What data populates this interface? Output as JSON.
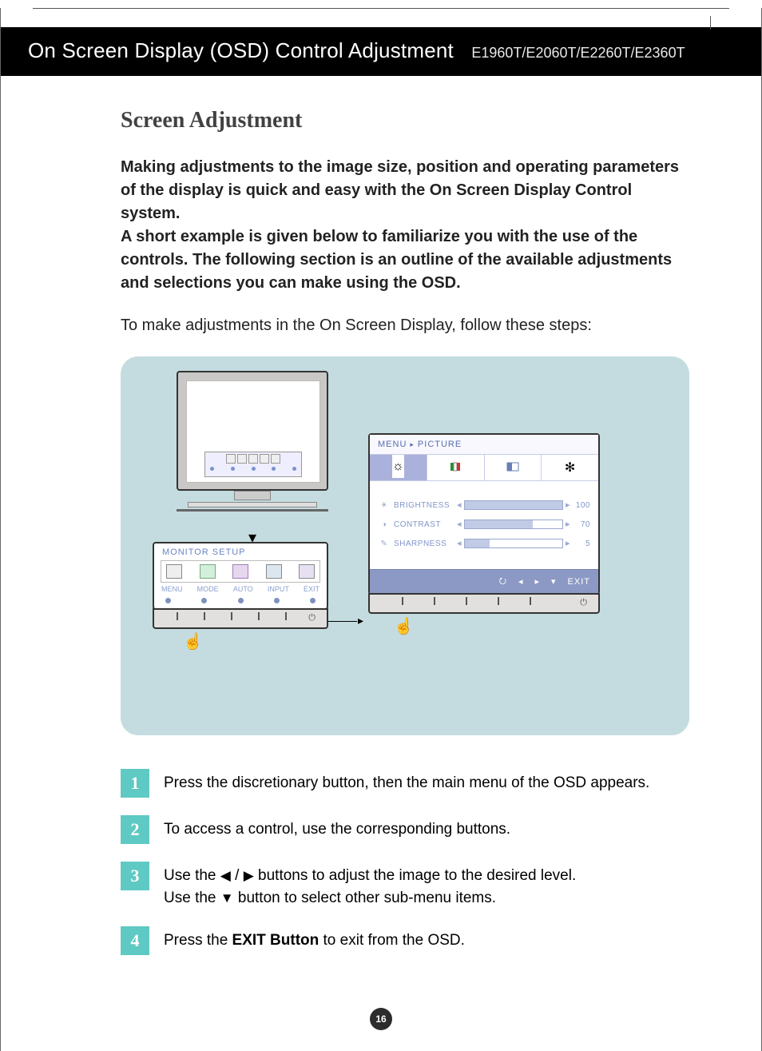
{
  "header": {
    "title": "On Screen Display (OSD) Control Adjustment",
    "models": "E1960T/E2060T/E2260T/E2360T"
  },
  "section_title": "Screen Adjustment",
  "intro_bold": "Making adjustments to the image size, position and operating parameters of the display is quick and easy with the On Screen Display Control system.\nA short example is given below to familiarize you with the use of the controls. The following section is an outline of the available adjustments and selections you can make using the OSD.",
  "intro_norm": "To make adjustments in the On Screen Display, follow these steps:",
  "monitor_setup": {
    "label": "MONITOR SETUP",
    "buttons": [
      "MENU",
      "MODE",
      "AUTO",
      "INPUT",
      "EXIT"
    ]
  },
  "picture_menu": {
    "title_prefix": "MENU",
    "title": "PICTURE",
    "rows": [
      {
        "label": "BRIGHTNESS",
        "value": "100",
        "fill": 100
      },
      {
        "label": "CONTRAST",
        "value": "70",
        "fill": 70
      },
      {
        "label": "SHARPNESS",
        "value": "5",
        "fill": 25
      }
    ],
    "nav_exit": "EXIT"
  },
  "steps": {
    "n1": "1",
    "t1": "Press the discretionary button, then the main menu of the OSD appears.",
    "n2": "2",
    "t2": "To access a control, use the corresponding buttons.",
    "n3": "3",
    "t3a": "Use the  ",
    "t3b": " buttons to adjust the image to the desired level.",
    "t3c": "Use the ",
    "t3d": "  button to select other sub-menu items.",
    "n4": "4",
    "t4a": "Press the ",
    "t4bold": "EXIT Button",
    "t4b": " to exit from the OSD."
  },
  "page_number": "16"
}
